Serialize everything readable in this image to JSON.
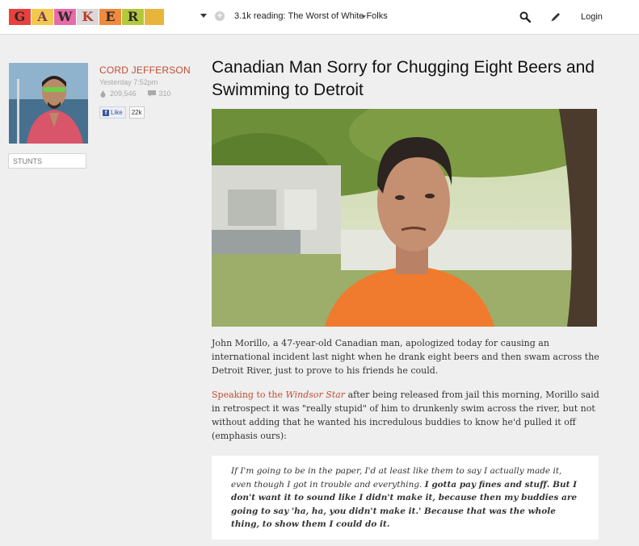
{
  "header": {
    "logo_letters": [
      "G",
      "A",
      "W",
      "K",
      "E",
      "R"
    ],
    "reading_count": "3.1k reading:",
    "reading_title": "The Worst of White Folks",
    "login_label": "Login",
    "icons": [
      "search-icon",
      "pen-icon",
      "add-icon",
      "dropdown-caret-icon"
    ]
  },
  "author": {
    "name": "CORD JEFFERSON",
    "time": "Yesterday 7:52pm",
    "views": "209,546",
    "comments": "310",
    "like_label": "Like",
    "like_count": "22k",
    "tag": "STUNTS"
  },
  "article": {
    "title": "Canadian Man Sorry for Chugging Eight Beers and Swimming to Detroit",
    "p1": "John Morillo, a 47-year-old Canadian man, apologized today for causing an international incident last night when he drank eight beers and then swam across the Detroit River, just to prove to his friends he could.",
    "p2_link_prefix": "Speaking to the ",
    "p2_link_source": "Windsor Star",
    "p2_rest": " after being released from jail this morning, Morillo said in retrospect it was \"really stupid\" of him to drunkenly swim across the river, but not without adding that he wanted his incredulous buddies to know he'd pulled it off (emphasis ours):",
    "quote_plain": "If I'm going to be in the paper, I'd at least like them to say I actually made it, even though I got in trouble and everything. ",
    "quote_bold": "I gotta pay fines and stuff. But I don't want it to sound like I didn't make it, because then my buddies are going to say 'ha, ha, you didn't make it.' Because that was the whole thing, to show them I could do it."
  },
  "colors": {
    "accent": "#c24d33",
    "background": "#efefef"
  }
}
